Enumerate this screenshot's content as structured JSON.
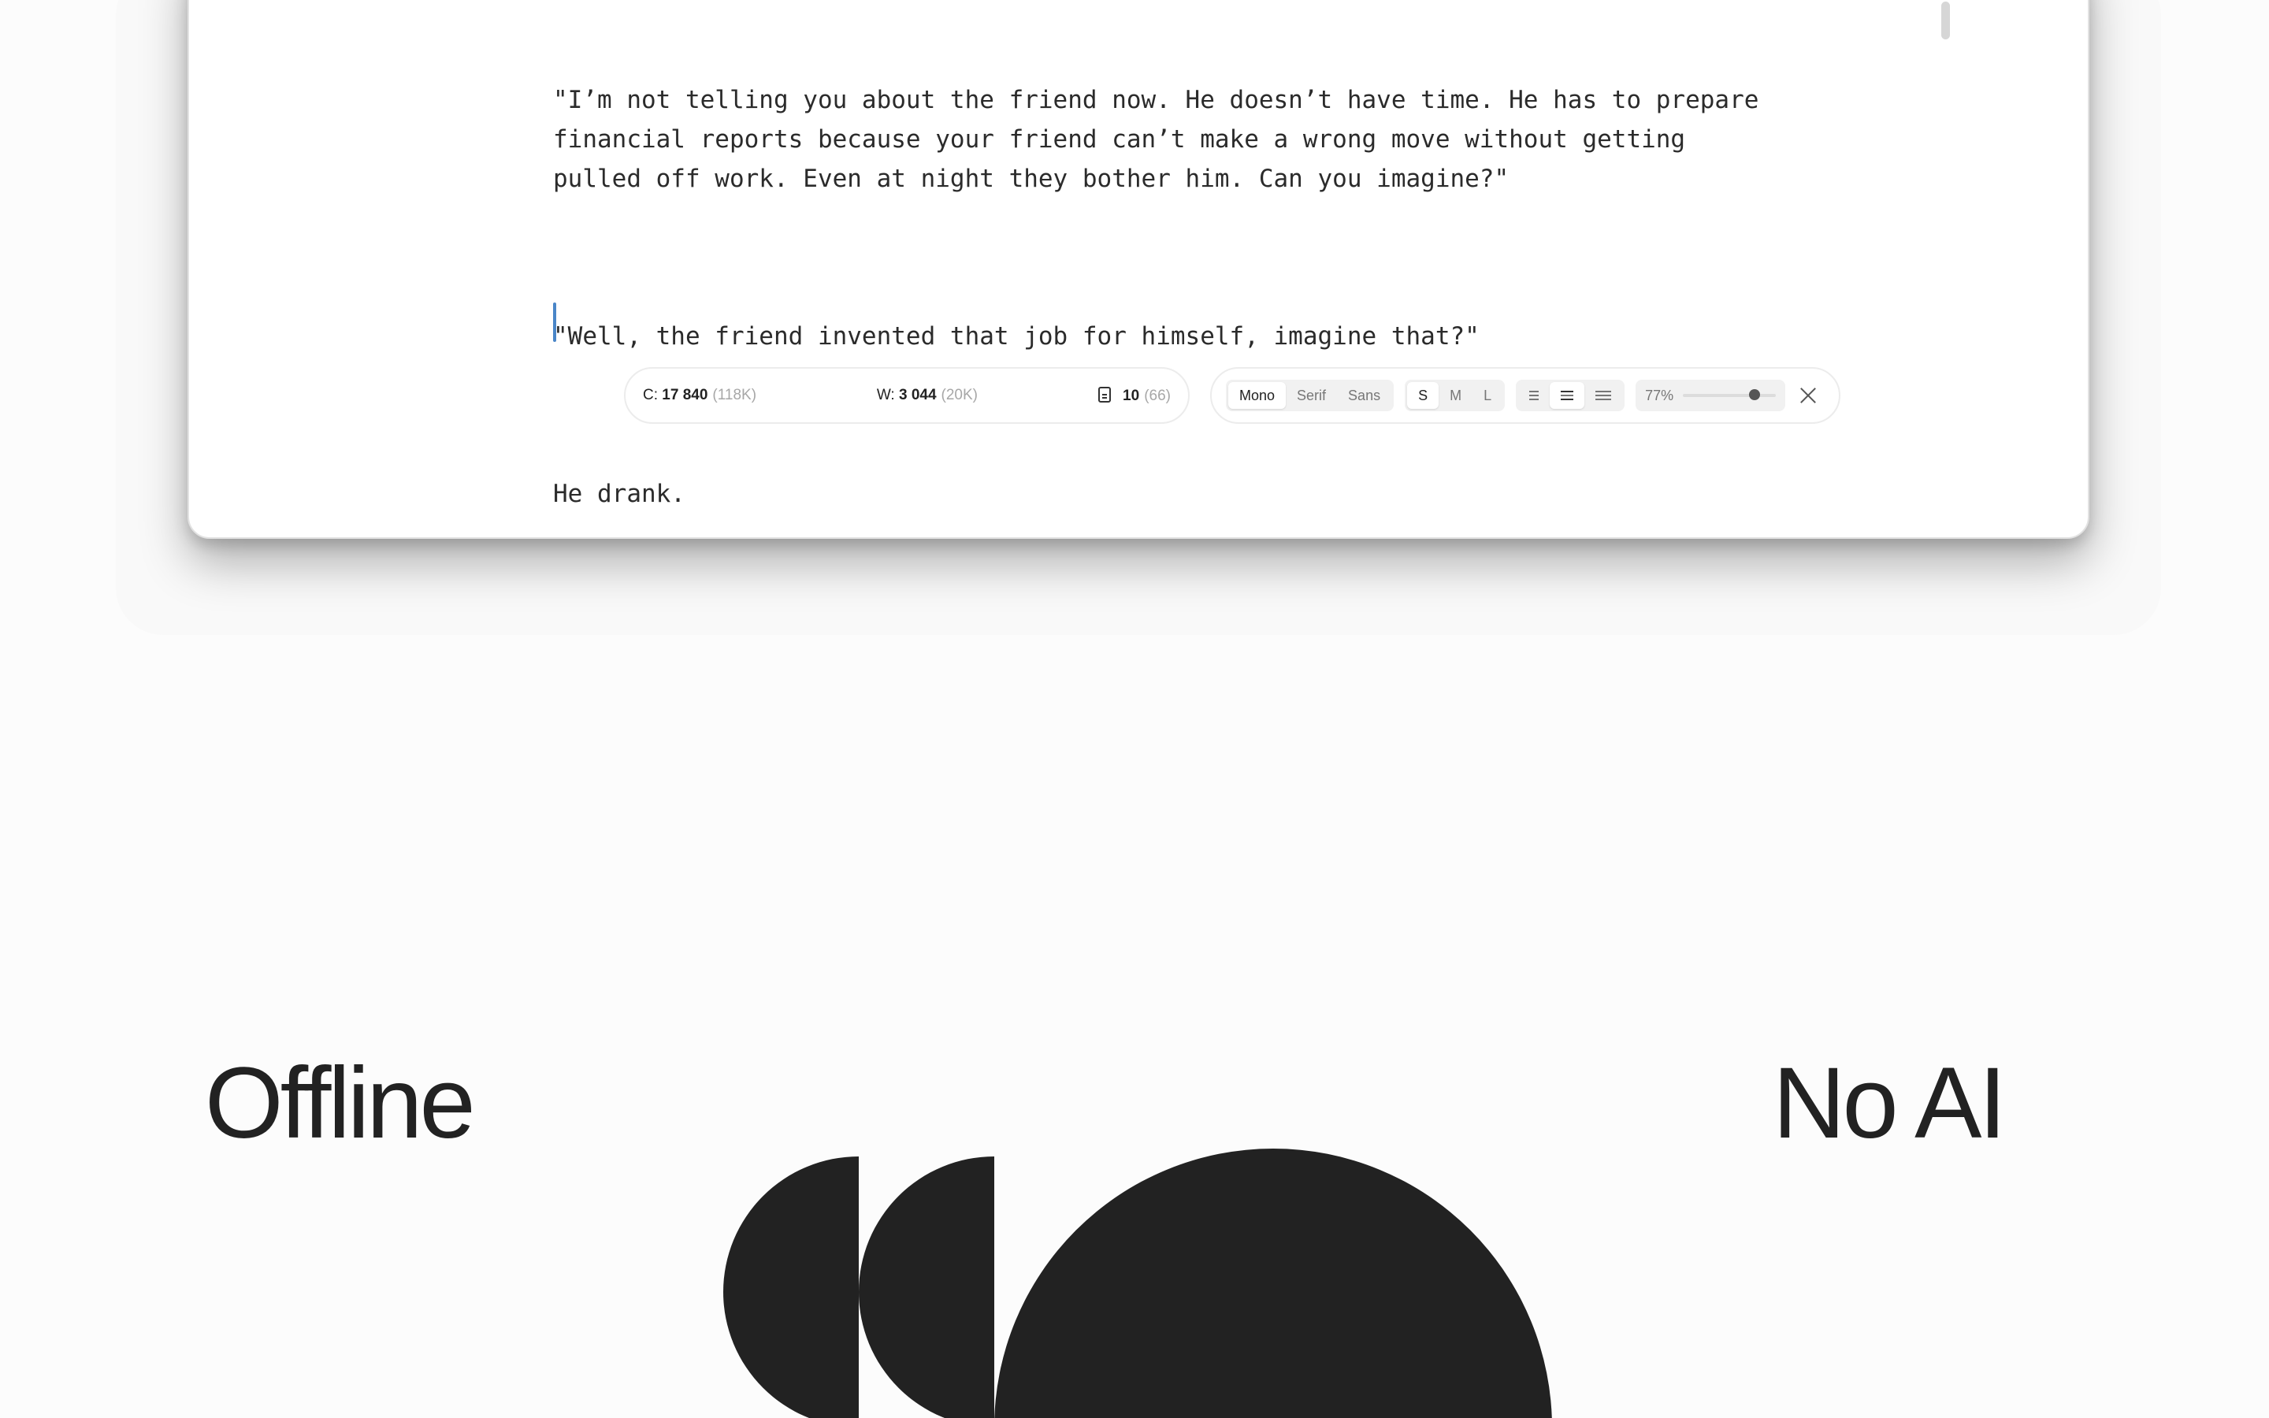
{
  "editor": {
    "paragraphs": [
      "\"I’m not telling you about the friend now. He doesn’t have time. He has to prepare financial reports because your friend can’t make a wrong move without getting pulled off work. Even at night they bother him. Can you imagine?\"",
      "\"Well, the friend invented that job for himself, imagine that?\"",
      "He drank."
    ]
  },
  "stats": {
    "chars_label": "C:",
    "chars_value": "17 840",
    "chars_total": "(118K)",
    "words_label": "W:",
    "words_value": "3 044",
    "words_total": "(20K)",
    "pages_value": "10",
    "pages_total": "(66)"
  },
  "controls": {
    "fonts": [
      "Mono",
      "Serif",
      "Sans"
    ],
    "active_font": "Mono",
    "sizes": [
      "S",
      "M",
      "L"
    ],
    "active_size": "S",
    "zoom_label": "77%",
    "zoom_fraction": 0.77
  },
  "headlines": {
    "left": "Offline",
    "right": "No AI"
  },
  "colors": {
    "accent_cursor": "#4a86c8",
    "ink": "#222222",
    "background": "#fcfcfc"
  },
  "icons": {
    "pages": "document-icon",
    "align": "align-lines-icon",
    "close": "close-icon",
    "view_left": "left-sidebar-icon",
    "view_full": "fullscreen-icon",
    "view_right": "right-sidebar-icon"
  }
}
